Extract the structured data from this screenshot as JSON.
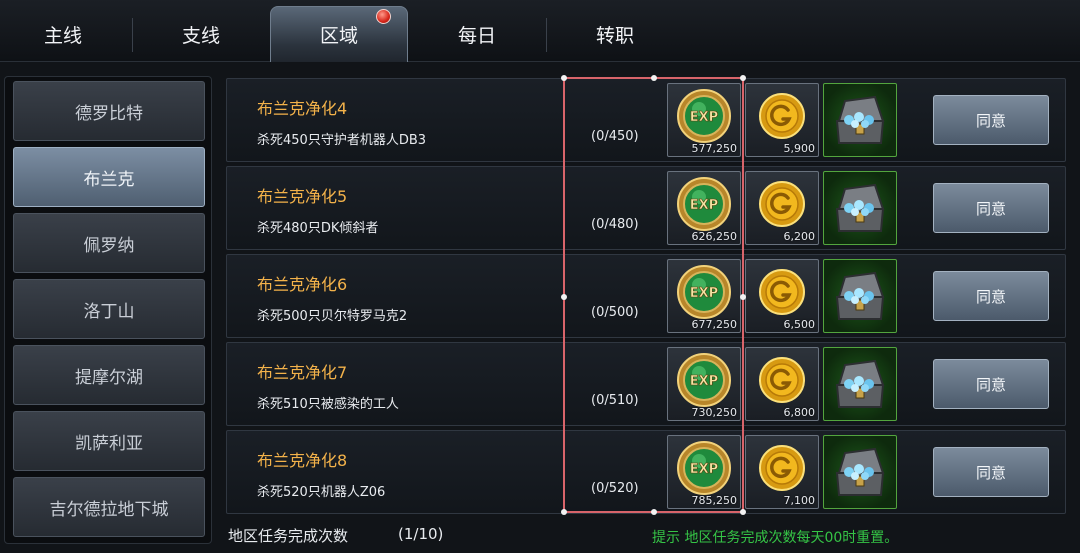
{
  "tabs": [
    {
      "label": "主线",
      "active": false
    },
    {
      "label": "支线",
      "active": false
    },
    {
      "label": "区域",
      "active": true,
      "has_notification": true
    },
    {
      "label": "每日",
      "active": false
    },
    {
      "label": "转职",
      "active": false
    }
  ],
  "regions": [
    {
      "label": "德罗比特",
      "active": false
    },
    {
      "label": "布兰克",
      "active": true
    },
    {
      "label": "佩罗纳",
      "active": false
    },
    {
      "label": "洛丁山",
      "active": false
    },
    {
      "label": "提摩尔湖",
      "active": false
    },
    {
      "label": "凯萨利亚",
      "active": false
    },
    {
      "label": "吉尔德拉地下城",
      "active": false
    }
  ],
  "quests": [
    {
      "title": "布兰克净化4",
      "desc": "杀死450只守护者机器人DB3",
      "progress": "(0/450)",
      "exp": "577,250",
      "gold": "5,900",
      "button": "同意"
    },
    {
      "title": "布兰克净化5",
      "desc": "杀死480只DK倾斜者",
      "progress": "(0/480)",
      "exp": "626,250",
      "gold": "6,200",
      "button": "同意"
    },
    {
      "title": "布兰克净化6",
      "desc": "杀死500只贝尔特罗马克2",
      "progress": "(0/500)",
      "exp": "677,250",
      "gold": "6,500",
      "button": "同意"
    },
    {
      "title": "布兰克净化7",
      "desc": "杀死510只被感染的工人",
      "progress": "(0/510)",
      "exp": "730,250",
      "gold": "6,800",
      "button": "同意"
    },
    {
      "title": "布兰克净化8",
      "desc": "杀死520只机器人Z06",
      "progress": "(0/520)",
      "exp": "785,250",
      "gold": "7,100",
      "button": "同意"
    }
  ],
  "reward_icons": {
    "exp": "exp-coin-icon",
    "gold": "gold-coin-icon",
    "chest": "treasure-chest-icon"
  },
  "footer": {
    "label": "地区任务完成次数",
    "count": "(1/10)",
    "tip": "提示  地区任务完成次数每天00时重置。"
  },
  "colors": {
    "quest_title": "#f3b24a",
    "tip_text": "#35c446",
    "selection_frame": "#d8646a",
    "chest_border": "#53a53e"
  }
}
